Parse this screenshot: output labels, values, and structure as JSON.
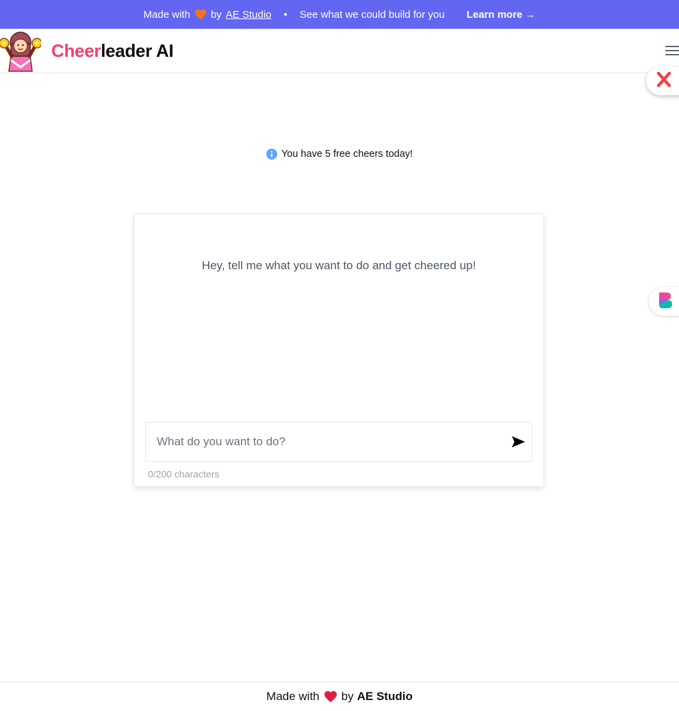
{
  "banner": {
    "made_with": "Made with",
    "by": "by",
    "studio": "AE Studio",
    "separator": "•",
    "pitch": "See what we could build for you",
    "learn_more": "Learn more →",
    "color": "#6366f1"
  },
  "header": {
    "brand_accent": "Cheer",
    "brand_rest": "leader AI",
    "accent_color": "#f0416c"
  },
  "notice": {
    "text": "You have 5 free cheers today!",
    "icon": "info-icon"
  },
  "chat": {
    "prompt": "Hey, tell me what you want to do and get cheered up!",
    "input_placeholder": "What do you want to do?",
    "input_value": "",
    "counter": "0/200 characters",
    "send_icon": "send-icon"
  },
  "footer": {
    "made_with": "Made with",
    "by": "by",
    "studio": "AE Studio"
  }
}
